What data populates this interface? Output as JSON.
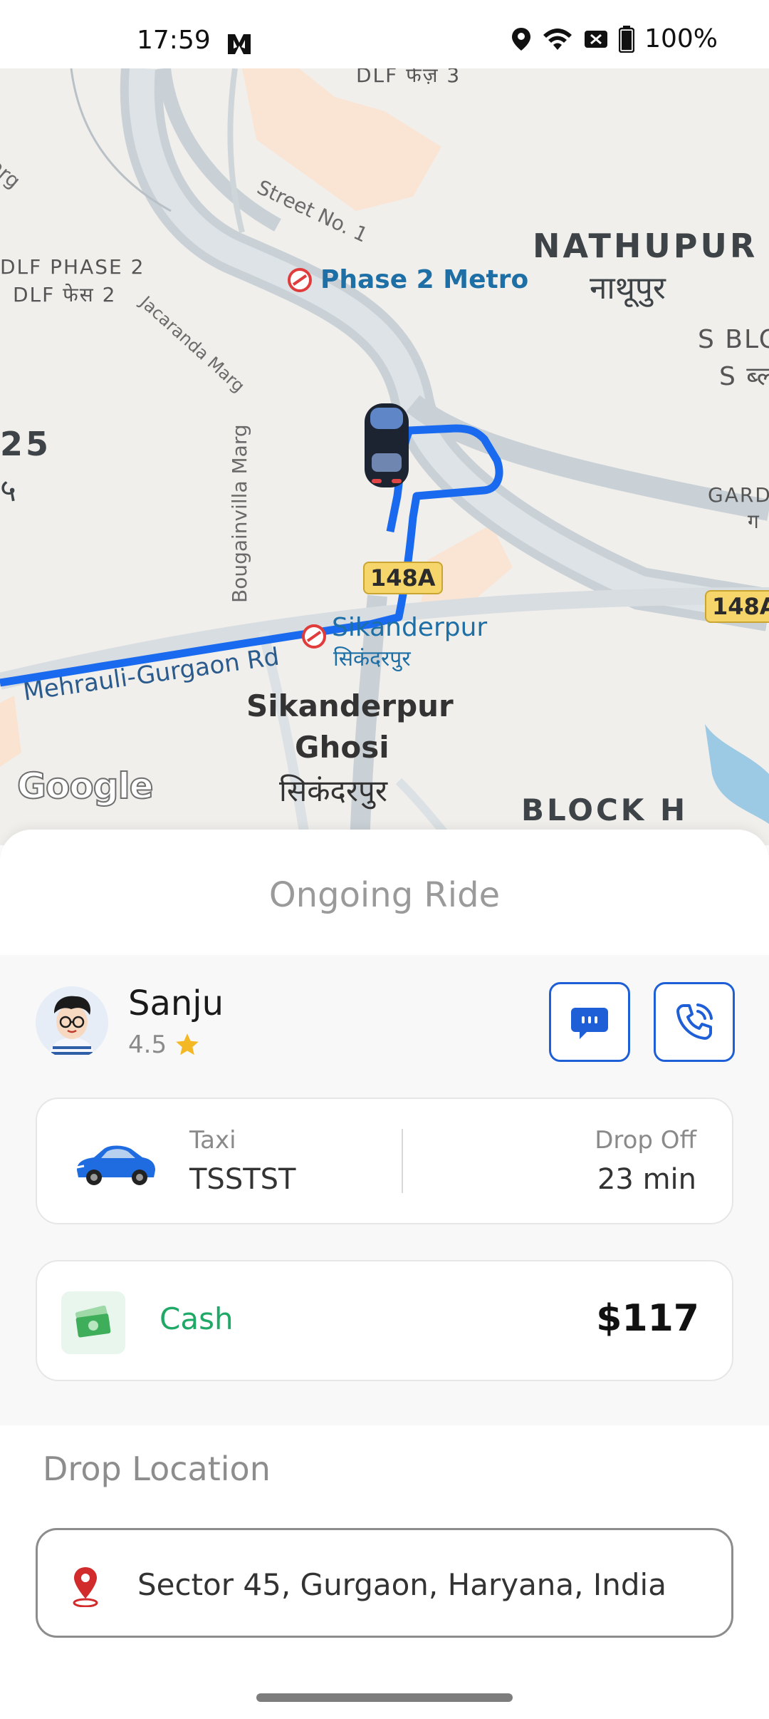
{
  "status_bar": {
    "time": "17:59",
    "battery": "100%",
    "icons": [
      "app-icon",
      "location-icon",
      "wifi-icon",
      "notification-icon",
      "battery-icon"
    ]
  },
  "map": {
    "labels": {
      "street_no_1": "Street No. 1",
      "dlf_top": "DLF फेज़ 3",
      "nathupur": "NATHUPUR",
      "nathupur_hindi": "नाथूपुर",
      "dlf_phase2": "DLF PHASE 2",
      "dlf_phase2_hindi": "DLF फेस 2",
      "phase2_metro": "Phase 2 Metro",
      "s_block": "S BLO",
      "s_block_hindi": "S ब्ल",
      "sector25": "25",
      "sector25_hindi": "५",
      "jacaranda": "Jacaranda Marg",
      "bougainvilla": "Bougainvilla Marg",
      "garden": "GARD",
      "garden_hindi": "ग",
      "route_148a": "148A",
      "route_148a_right": "148A",
      "sikanderpur_metro": "Sikanderpur",
      "sikanderpur_metro_hindi": "सिकंदरपुर",
      "mehrauli_road": "Mehrauli-Gurgaon Rd",
      "sikanderpur_ghosi_1": "Sikanderpur",
      "sikanderpur_ghosi_2": "Ghosi",
      "sikanderpur_ghosi_hindi": "सिकंदरपुर",
      "block_h": "BLOCK H",
      "marg_left": "arg"
    },
    "google_logo": "Google"
  },
  "ride": {
    "title": "Ongoing Ride",
    "driver": {
      "name": "Sanju",
      "rating": "4.5"
    },
    "vehicle": {
      "type_label": "Taxi",
      "plate": "TSSTST"
    },
    "dropoff": {
      "label": "Drop Off",
      "eta": "23 min"
    },
    "payment": {
      "method": "Cash",
      "amount": "$117"
    },
    "drop_location": {
      "heading": "Drop Location",
      "address": "Sector 45, Gurgaon, Haryana, India"
    }
  },
  "colors": {
    "accent_blue": "#1e5fd8",
    "cash_green": "#1fa866",
    "star_yellow": "#f5b825",
    "route_blue": "#1a6af0",
    "pin_red": "#d12b2b"
  }
}
